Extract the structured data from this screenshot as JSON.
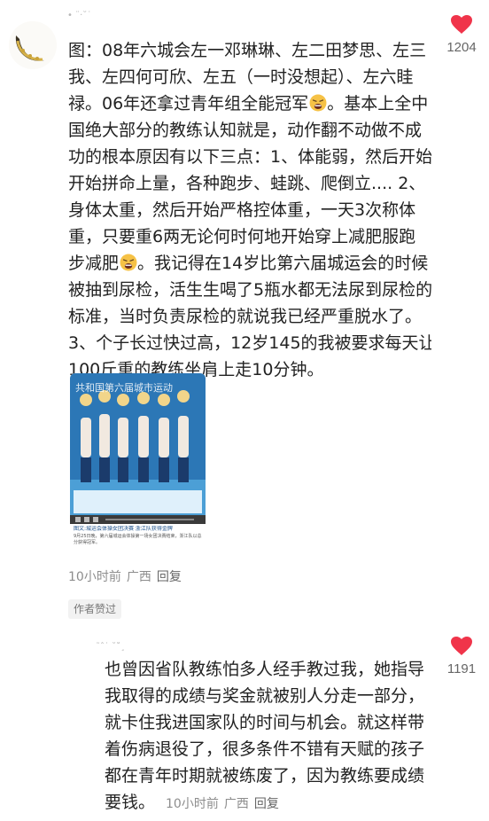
{
  "comments": [
    {
      "username": "• ¨·˘˙",
      "lines": [
        "图：08年六城会左一邓琳琳、左二田梦思、左三",
        "我、左四何可欣、左五（一时没想起）、左六眭",
        "禄。06年还拿过青年组全能冠军",
        "国绝大部分的教练认知就是，动作翻不动做不成",
        "功的根本原因有以下三点：1、体能弱，然后开始",
        "开始拼命上量，各种跑步、蛙跳、爬倒立.... 2、",
        "身体太重，然后开始严格控体重，一天3次称体",
        "重，只要重6两无论何时何地开始穿上减肥服跑",
        "步减肥",
        "被抽到尿检，活生生喝了5瓶水都无法尿到尿检的",
        "标准，当时负责尿检的就说我已经严重脱水了。",
        "3、个子长过快过高，12岁145的我被要求每天让",
        "100斤重的教练坐肩上走10分钟。"
      ],
      "line3_tail": "。基本上全中",
      "line9_tail": "。我记得在14岁比第六届城运会的时候",
      "emoji_icon": "tired-face-emoji",
      "photo": {
        "banner_text": "共和国第六届城市运动",
        "caption_title": "图文:城运会体操女团决赛 浙江队获得金牌",
        "caption_body": "9月25日晚，第六届城运会体操第一场女团决赛结束，浙江队以总分获得冠军。",
        "icon": "video-player-thumbnail"
      },
      "time": "10小时前",
      "location": "广西",
      "reply_label": "回复",
      "author_liked": "作者赞过",
      "likes": "1204"
    },
    {
      "username": "˜ˆ˙ ˘˚¸",
      "lines": [
        "也曾因省队教练怕多人经手教过我，她指导",
        "我取得的成绩与奖金就被别人分走一部分，",
        "就卡住我进国家队的时间与机会。就这样带",
        "着伤病退役了，很多条件不错有天赋的孩子",
        "都在青年时期就被练废了，因为教练要成绩",
        "要钱。"
      ],
      "time": "10小时前",
      "location": "广西",
      "reply_label": "回复",
      "likes": "1191"
    }
  ],
  "colors": {
    "heart": "#f0344a",
    "text": "#222222",
    "meta": "#8d8d8d"
  },
  "icons": {
    "like": "heart-icon",
    "avatar": "avatar"
  }
}
